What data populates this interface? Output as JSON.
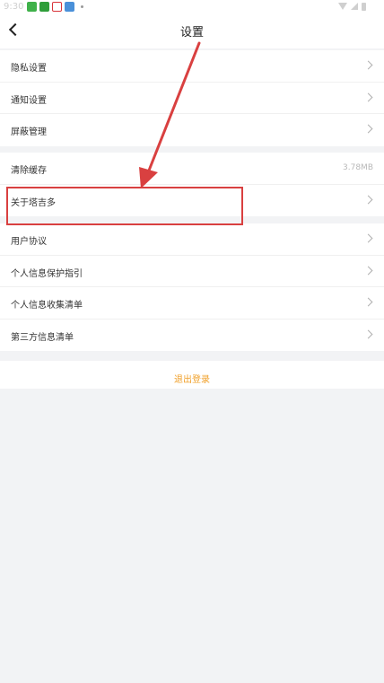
{
  "status_bar": {
    "time": "9:30",
    "app_icons": [
      "app-icon-green",
      "app-icon-green",
      "app-icon-red",
      "app-icon-blue"
    ]
  },
  "header": {
    "title": "设置"
  },
  "groups": [
    {
      "items": [
        {
          "label": "隐私设置"
        },
        {
          "label": "通知设置"
        },
        {
          "label": "屏蔽管理"
        }
      ]
    },
    {
      "items": [
        {
          "label": "清除缓存",
          "value": "3.78MB"
        },
        {
          "label": "关于塔吉多"
        }
      ]
    },
    {
      "items": [
        {
          "label": "用户协议"
        },
        {
          "label": "个人信息保护指引"
        },
        {
          "label": "个人信息收集清单"
        },
        {
          "label": "第三方信息清单"
        }
      ]
    }
  ],
  "logout": {
    "label": "退出登录"
  },
  "annotation": {
    "color": "#d94040"
  },
  "colors": {
    "logout": "#f0a02a",
    "background": "#f2f3f5"
  }
}
